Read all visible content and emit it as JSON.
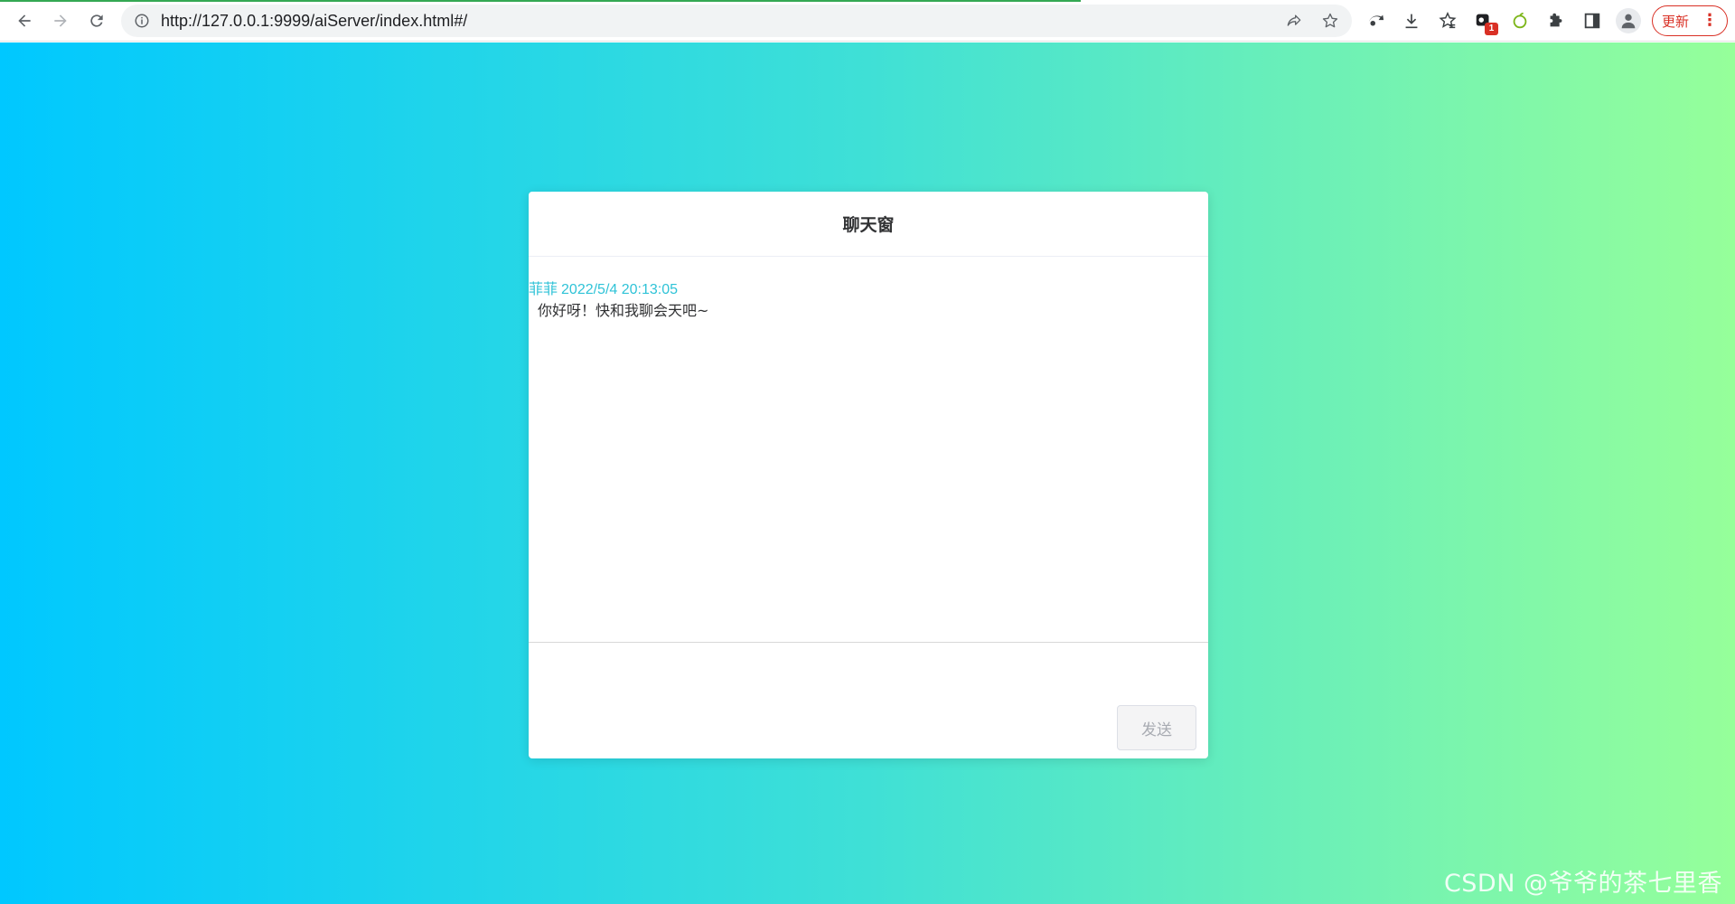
{
  "browser": {
    "url": "http://127.0.0.1:9999/aiServer/index.html#/",
    "extension_badge": "1",
    "update_label": "更新",
    "menu_glyph": "⋮",
    "icons": {
      "back": "back-arrow-icon",
      "forward": "forward-arrow-icon",
      "reload": "reload-icon",
      "site_info": "info-icon",
      "share": "share-icon",
      "bookmark": "star-icon"
    }
  },
  "chat": {
    "title": "聊天窗",
    "messages": [
      {
        "sender": "菲菲",
        "time": "2022/5/4 20:13:05",
        "content": "你好呀！快和我聊会天吧~"
      }
    ],
    "input_value": "",
    "send_label": "发送"
  },
  "watermark": "CSDN @爷爷的茶七里香",
  "colors": {
    "gradient_start": "#00c8ff",
    "gradient_end": "#96ff9a",
    "sender_color": "#2fc3d7",
    "update_red": "#d93025"
  }
}
